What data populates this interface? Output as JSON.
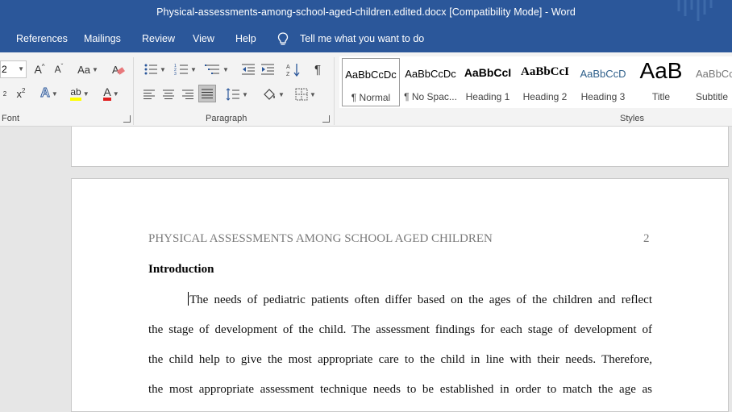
{
  "titlebar": {
    "title": "Physical-assessments-among-school-aged-children.edited.docx [Compatibility Mode]  -  Word"
  },
  "tabs": [
    {
      "label": "References"
    },
    {
      "label": "Mailings"
    },
    {
      "label": "Review"
    },
    {
      "label": "View"
    },
    {
      "label": "Help"
    }
  ],
  "tellme": {
    "label": "Tell me what you want to do",
    "icon": "lightbulb-icon"
  },
  "ribbon": {
    "font_size_value": "2",
    "grow_label": "A",
    "shrink_label": "A",
    "case_label": "Aa",
    "superscript_sub": "2",
    "superscript_label": "x",
    "subscript_label": "x",
    "superscript_sup": "2",
    "text_effects_label": "A",
    "highlight_label": "ab",
    "font_color_label": "A",
    "font_group_label": "Font",
    "paragraph_group_label": "Paragraph",
    "styles_group_label": "Styles",
    "colors": {
      "highlight": "#ffff00",
      "font_color": "#e02020",
      "accent": "#2b579a"
    }
  },
  "styles": [
    {
      "preview": "AaBbCcDc",
      "name": "¶ Normal",
      "selected": true
    },
    {
      "preview": "AaBbCcDc",
      "name": "¶ No Spac..."
    },
    {
      "preview": "AaBbCcI",
      "name": "Heading 1"
    },
    {
      "preview": "AaBbCcI",
      "name": "Heading 2"
    },
    {
      "preview": "AaBbCcD",
      "name": "Heading 3"
    },
    {
      "preview": "AaB",
      "name": "Title"
    },
    {
      "preview": "AaBbCcD",
      "name": "Subtitle"
    }
  ],
  "document": {
    "running_head": "PHYSICAL ASSESSMENTS AMONG SCHOOL AGED CHILDREN",
    "page_number": "2",
    "heading": "Introduction",
    "lines": [
      "The needs of pediatric patients often differ based on the ages of the children and reflect",
      "the stage of development of the child. The assessment findings for each stage of development of",
      "the child help to give the most appropriate care to the child in line with their needs. Therefore,",
      "the most appropriate assessment technique needs to be established in order to match the age as"
    ]
  }
}
